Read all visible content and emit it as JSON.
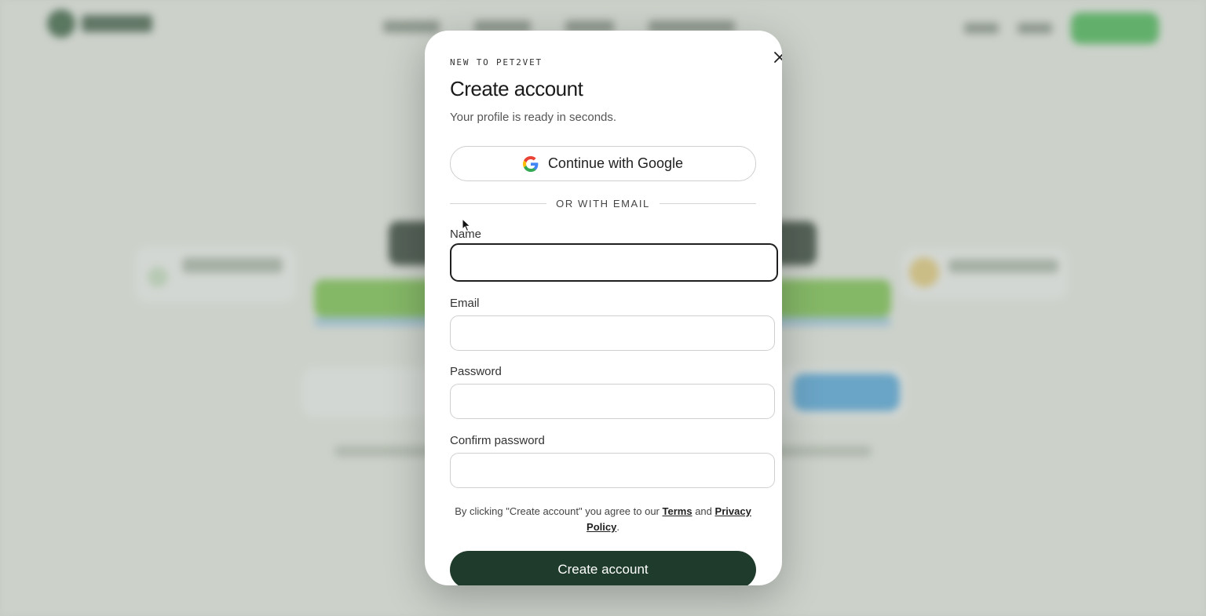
{
  "modal": {
    "eyebrow": "NEW TO PET2VET",
    "title": "Create account",
    "subtitle": "Your profile is ready in seconds.",
    "google_label": "Continue with Google",
    "divider_label": "OR WITH EMAIL",
    "fields": {
      "name": {
        "label": "Name",
        "value": "",
        "placeholder": ""
      },
      "email": {
        "label": "Email",
        "value": "",
        "placeholder": ""
      },
      "password": {
        "label": "Password",
        "value": "",
        "placeholder": ""
      },
      "confirm": {
        "label": "Confirm password",
        "value": "",
        "placeholder": ""
      }
    },
    "legal": {
      "prefix": "By clicking \"Create account\" you agree to our",
      "terms": "Terms",
      "and": "and",
      "privacy": "Privacy Policy",
      "suffix": "."
    },
    "submit_label": "Create account",
    "colors": {
      "primary": "#1f3b2b",
      "background_accent": "#3dbb4d"
    }
  }
}
